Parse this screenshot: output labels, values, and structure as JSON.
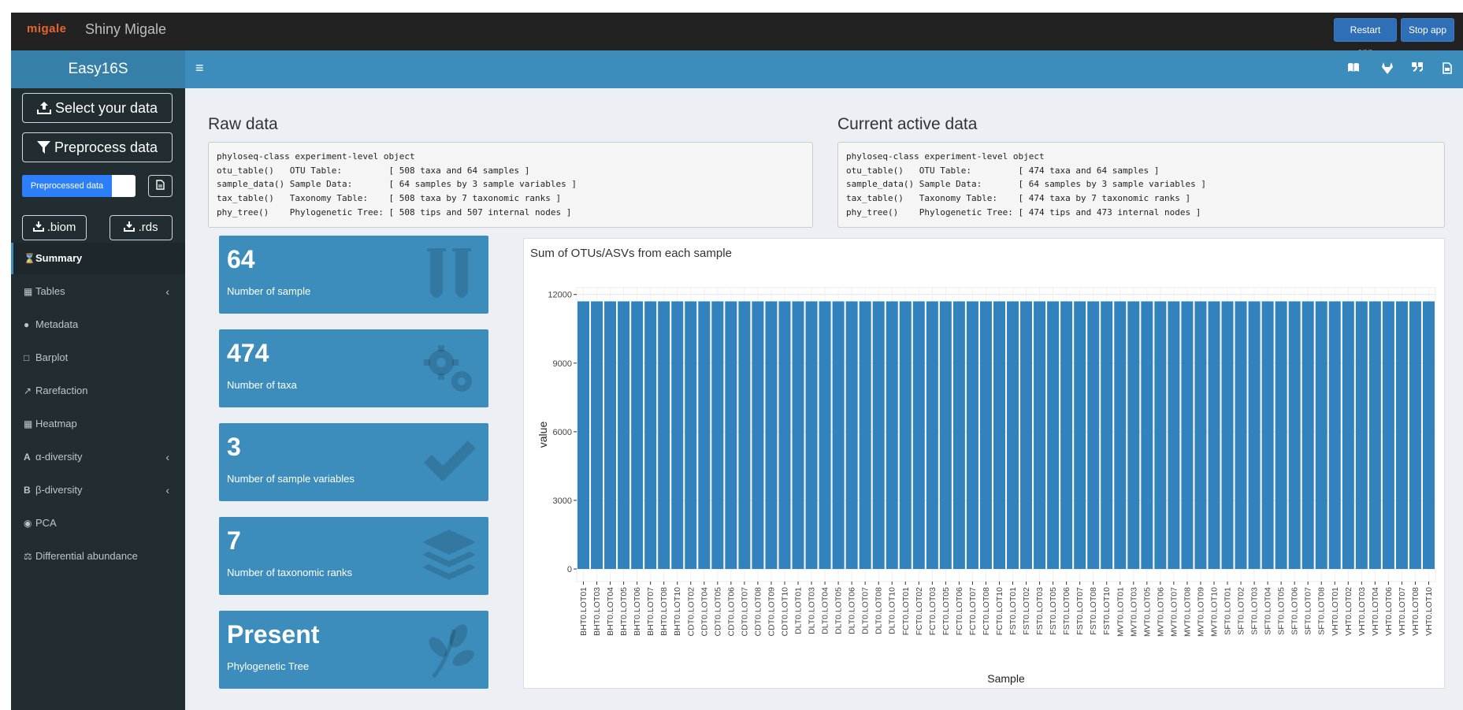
{
  "topbar": {
    "logo": "migale",
    "title": "Shiny Migale",
    "restart_label": "Restart app",
    "stop_label": "Stop app"
  },
  "header": {
    "app_title": "Easy16S",
    "icons": [
      "book-icon",
      "gitlab-icon",
      "quote-icon",
      "file-icon"
    ]
  },
  "sidebar": {
    "select_data_label": "Select your data",
    "preprocess_label": "Preprocess data",
    "toggle_label": "Preprocessed data",
    "download_biom": ".biom",
    "download_rds": ".rds",
    "menu": [
      {
        "label": "Summary",
        "icon": "hourglass-icon",
        "active": true,
        "chevron": false
      },
      {
        "label": "Tables",
        "icon": "table-icon",
        "active": false,
        "chevron": true
      },
      {
        "label": "Metadata",
        "icon": "palette-icon",
        "active": false,
        "chevron": false
      },
      {
        "label": "Barplot",
        "icon": "bar-chart-icon",
        "active": false,
        "chevron": false
      },
      {
        "label": "Rarefaction",
        "icon": "line-chart-icon",
        "active": false,
        "chevron": false
      },
      {
        "label": "Heatmap",
        "icon": "grid-icon",
        "active": false,
        "chevron": false
      },
      {
        "label": "α-diversity",
        "icon": "alpha-icon",
        "active": false,
        "chevron": true
      },
      {
        "label": "β-diversity",
        "icon": "beta-icon",
        "active": false,
        "chevron": true
      },
      {
        "label": "PCA",
        "icon": "target-icon",
        "active": false,
        "chevron": false
      },
      {
        "label": "Differential abundance",
        "icon": "balance-icon",
        "active": false,
        "chevron": false
      }
    ]
  },
  "raw": {
    "title": "Raw data",
    "text": "phyloseq-class experiment-level object\notu_table()   OTU Table:         [ 508 taxa and 64 samples ]\nsample_data() Sample Data:       [ 64 samples by 3 sample variables ]\ntax_table()   Taxonomy Table:    [ 508 taxa by 7 taxonomic ranks ]\nphy_tree()    Phylogenetic Tree: [ 508 tips and 507 internal nodes ]"
  },
  "active": {
    "title": "Current active data",
    "text": "phyloseq-class experiment-level object\notu_table()   OTU Table:         [ 474 taxa and 64 samples ]\nsample_data() Sample Data:       [ 64 samples by 3 sample variables ]\ntax_table()   Taxonomy Table:    [ 474 taxa by 7 taxonomic ranks ]\nphy_tree()    Phylogenetic Tree: [ 474 tips and 473 internal nodes ]"
  },
  "value_boxes": [
    {
      "value": "64",
      "label": "Number of sample",
      "icon": "test-tubes-icon"
    },
    {
      "value": "474",
      "label": "Number of taxa",
      "icon": "cogs-icon"
    },
    {
      "value": "3",
      "label": "Number of sample variables",
      "icon": "check-icon"
    },
    {
      "value": "7",
      "label": "Number of taxonomic ranks",
      "icon": "layers-icon"
    },
    {
      "value": "Present",
      "label": "Phylogenetic Tree",
      "icon": "leaf-icon"
    }
  ],
  "chart_data": {
    "type": "bar",
    "title": "Sum of OTUs/ASVs from each sample",
    "xlabel": "Sample",
    "ylabel": "value",
    "ylim": [
      0,
      12000
    ],
    "yticks": [
      0,
      3000,
      6000,
      9000,
      12000
    ],
    "bar_color": "#3182bd",
    "categories": [
      "BHT0.LOT01",
      "BHT0.LOT03",
      "BHT0.LOT04",
      "BHT0.LOT05",
      "BHT0.LOT06",
      "BHT0.LOT07",
      "BHT0.LOT08",
      "BHT0.LOT10",
      "CDT0.LOT02",
      "CDT0.LOT04",
      "CDT0.LOT05",
      "CDT0.LOT06",
      "CDT0.LOT07",
      "CDT0.LOT08",
      "CDT0.LOT09",
      "CDT0.LOT10",
      "DLT0.LOT01",
      "DLT0.LOT03",
      "DLT0.LOT04",
      "DLT0.LOT05",
      "DLT0.LOT06",
      "DLT0.LOT07",
      "DLT0.LOT08",
      "DLT0.LOT10",
      "FCT0.LOT01",
      "FCT0.LOT02",
      "FCT0.LOT03",
      "FCT0.LOT05",
      "FCT0.LOT06",
      "FCT0.LOT07",
      "FCT0.LOT08",
      "FCT0.LOT10",
      "FST0.LOT01",
      "FST0.LOT02",
      "FST0.LOT03",
      "FST0.LOT05",
      "FST0.LOT06",
      "FST0.LOT07",
      "FST0.LOT08",
      "FST0.LOT10",
      "MVT0.LOT01",
      "MVT0.LOT03",
      "MVT0.LOT05",
      "MVT0.LOT06",
      "MVT0.LOT07",
      "MVT0.LOT08",
      "MVT0.LOT09",
      "MVT0.LOT10",
      "SFT0.LOT01",
      "SFT0.LOT02",
      "SFT0.LOT03",
      "SFT0.LOT04",
      "SFT0.LOT05",
      "SFT0.LOT06",
      "SFT0.LOT07",
      "SFT0.LOT08",
      "VHT0.LOT01",
      "VHT0.LOT02",
      "VHT0.LOT03",
      "VHT0.LOT04",
      "VHT0.LOT06",
      "VHT0.LOT07",
      "VHT0.LOT08",
      "VHT0.LOT10"
    ],
    "values": [
      11700,
      11700,
      11700,
      11700,
      11700,
      11700,
      11700,
      11700,
      11700,
      11700,
      11700,
      11700,
      11700,
      11700,
      11700,
      11700,
      11700,
      11700,
      11700,
      11700,
      11700,
      11700,
      11700,
      11700,
      11700,
      11700,
      11700,
      11700,
      11700,
      11700,
      11700,
      11700,
      11700,
      11700,
      11700,
      11700,
      11700,
      11700,
      11700,
      11700,
      11700,
      11700,
      11700,
      11700,
      11700,
      11700,
      11700,
      11700,
      11700,
      11700,
      11700,
      11700,
      11700,
      11700,
      11700,
      11700,
      11700,
      11700,
      11700,
      11700,
      11700,
      11700,
      11700,
      11700
    ],
    "grid": true,
    "legend": "none"
  }
}
